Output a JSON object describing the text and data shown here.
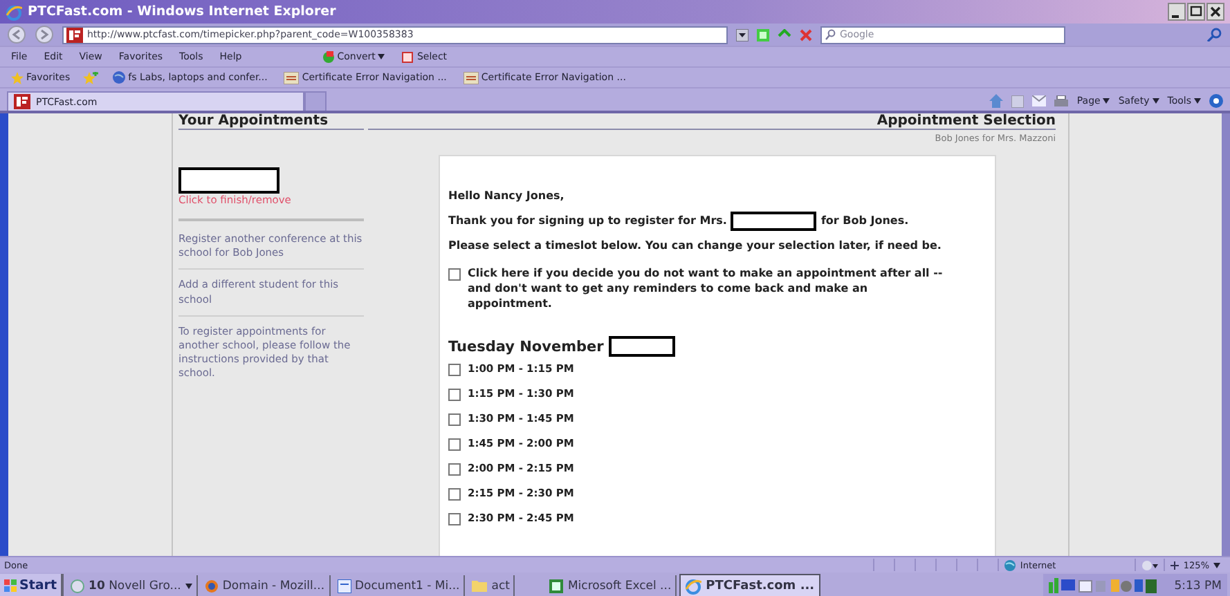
{
  "window": {
    "title": "PTCFast.com - Windows Internet Explorer"
  },
  "address_bar": {
    "value": "http://www.ptcfast.com/timepicker.php?parent_code=W100358383"
  },
  "search": {
    "placeholder": "Google"
  },
  "menu": [
    "File",
    "Edit",
    "View",
    "Favorites",
    "Tools",
    "Help"
  ],
  "toolbar_buttons": [
    "Convert",
    "Select"
  ],
  "favorites_bar": {
    "label": "Favorites",
    "links": [
      "fs Labs, laptops and confer...",
      "Certificate Error Navigation ...",
      "Certificate Error Navigation ..."
    ]
  },
  "tabs": [
    {
      "label": "PTCFast.com",
      "selected": true
    }
  ],
  "command_bar": [
    "Page",
    "Safety",
    "Tools"
  ],
  "page": {
    "sidebar": {
      "heading": "Your Appointments",
      "remove_link": "Click to finish/remove",
      "links": [
        "Register another conference at this school for Bob Jones",
        "Add a different student for this school"
      ],
      "note": "To register appointments for another school, please follow the instructions provided by that school."
    },
    "header": {
      "title": "Appointment Selection",
      "subtitle": "Bob Jones for Mrs. Mazzoni"
    },
    "greeting": "Hello Nancy Jones,",
    "thanks_before": "Thank you for signing up to register for Mrs.",
    "thanks_after": "for Bob Jones.",
    "instructions": "Please select a timeslot below. You can change your selection later, if need be.",
    "opt_out": {
      "label": "Click here if you decide you do not want to make an appointment after all -- and don't want to get any reminders to come back and make an appointment.",
      "checked": false
    },
    "day": "Tuesday November",
    "timeslots": [
      {
        "label": "1:00 PM - 1:15 PM",
        "checked": false
      },
      {
        "label": "1:15 PM - 1:30 PM",
        "checked": false
      },
      {
        "label": "1:30 PM - 1:45 PM",
        "checked": false
      },
      {
        "label": "1:45 PM - 2:00 PM",
        "checked": false
      },
      {
        "label": "2:00 PM - 2:15 PM",
        "checked": false
      },
      {
        "label": "2:15 PM - 2:30 PM",
        "checked": false
      },
      {
        "label": "2:30 PM - 2:45 PM",
        "checked": false
      }
    ]
  },
  "status_bar": {
    "text": "Done",
    "zone": "Internet",
    "zoom": "125%"
  },
  "taskbar": {
    "start": "Start",
    "items": [
      {
        "label": "**10** Novell Gro...",
        "selected": false
      },
      {
        "label": "Domain - Mozill...",
        "selected": false
      },
      {
        "label": "Document1 - Mi...",
        "selected": false
      },
      {
        "label": "act",
        "selected": false
      },
      {
        "label": "Microsoft Excel ...",
        "selected": false
      },
      {
        "label": "PTCFast.com ...",
        "selected": true
      }
    ],
    "clock": "5:13 PM"
  }
}
